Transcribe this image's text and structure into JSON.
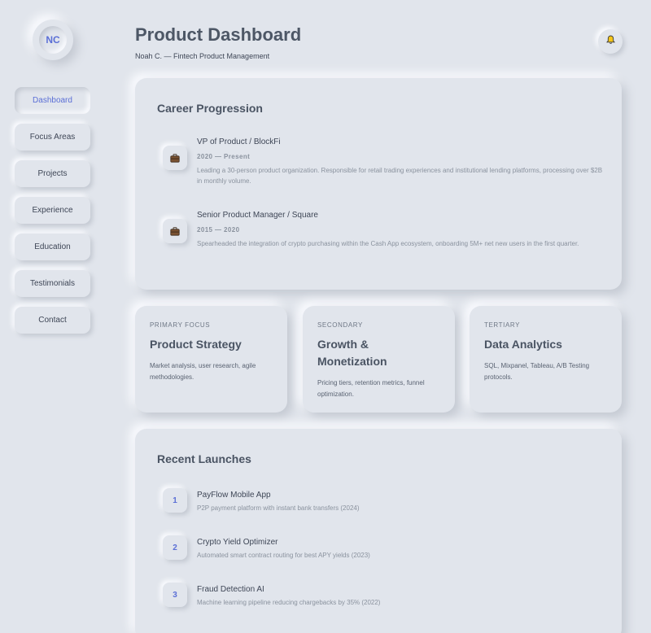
{
  "profile": {
    "initials": "NC"
  },
  "nav": {
    "items": [
      {
        "label": "Dashboard",
        "active": true
      },
      {
        "label": "Focus Areas",
        "active": false
      },
      {
        "label": "Projects",
        "active": false
      },
      {
        "label": "Experience",
        "active": false
      },
      {
        "label": "Education",
        "active": false
      },
      {
        "label": "Testimonials",
        "active": false
      },
      {
        "label": "Contact",
        "active": false
      }
    ]
  },
  "header": {
    "title": "Product Dashboard",
    "subtitle": "Noah C. — Fintech Product Management",
    "bell_icon": "bell-icon"
  },
  "career": {
    "title": "Career Progression",
    "icon": "briefcase-icon",
    "jobs": [
      {
        "title": "VP of Product / BlockFi",
        "dates": "2020 — Present",
        "description": "Leading a 30-person product organization. Responsible for retail trading experiences and institutional lending platforms, processing over $2B in monthly volume."
      },
      {
        "title": "Senior Product Manager / Square",
        "dates": "2015 — 2020",
        "description": "Spearheaded the integration of crypto purchasing within the Cash App ecosystem, onboarding 5M+ net new users in the first quarter."
      }
    ]
  },
  "focus": [
    {
      "label": "PRIMARY FOCUS",
      "title": "Product Strategy",
      "description": "Market analysis, user research, agile methodologies."
    },
    {
      "label": "SECONDARY",
      "title": "Growth & Monetization",
      "description": "Pricing tiers, retention metrics, funnel optimization."
    },
    {
      "label": "TERTIARY",
      "title": "Data Analytics",
      "description": "SQL, Mixpanel, Tableau, A/B Testing protocols."
    }
  ],
  "launches": {
    "title": "Recent Launches",
    "items": [
      {
        "num": "1",
        "title": "PayFlow Mobile App",
        "description": "P2P payment platform with instant bank transfers (2024)"
      },
      {
        "num": "2",
        "title": "Crypto Yield Optimizer",
        "description": "Automated smart contract routing for best APY yields (2023)"
      },
      {
        "num": "3",
        "title": "Fraud Detection AI",
        "description": "Machine learning pipeline reducing chargebacks by 35% (2022)"
      }
    ]
  },
  "colors": {
    "background": "#e1e5ec",
    "accent": "#5b6fd6",
    "text": "#4a5463",
    "muted": "#8a929e"
  }
}
